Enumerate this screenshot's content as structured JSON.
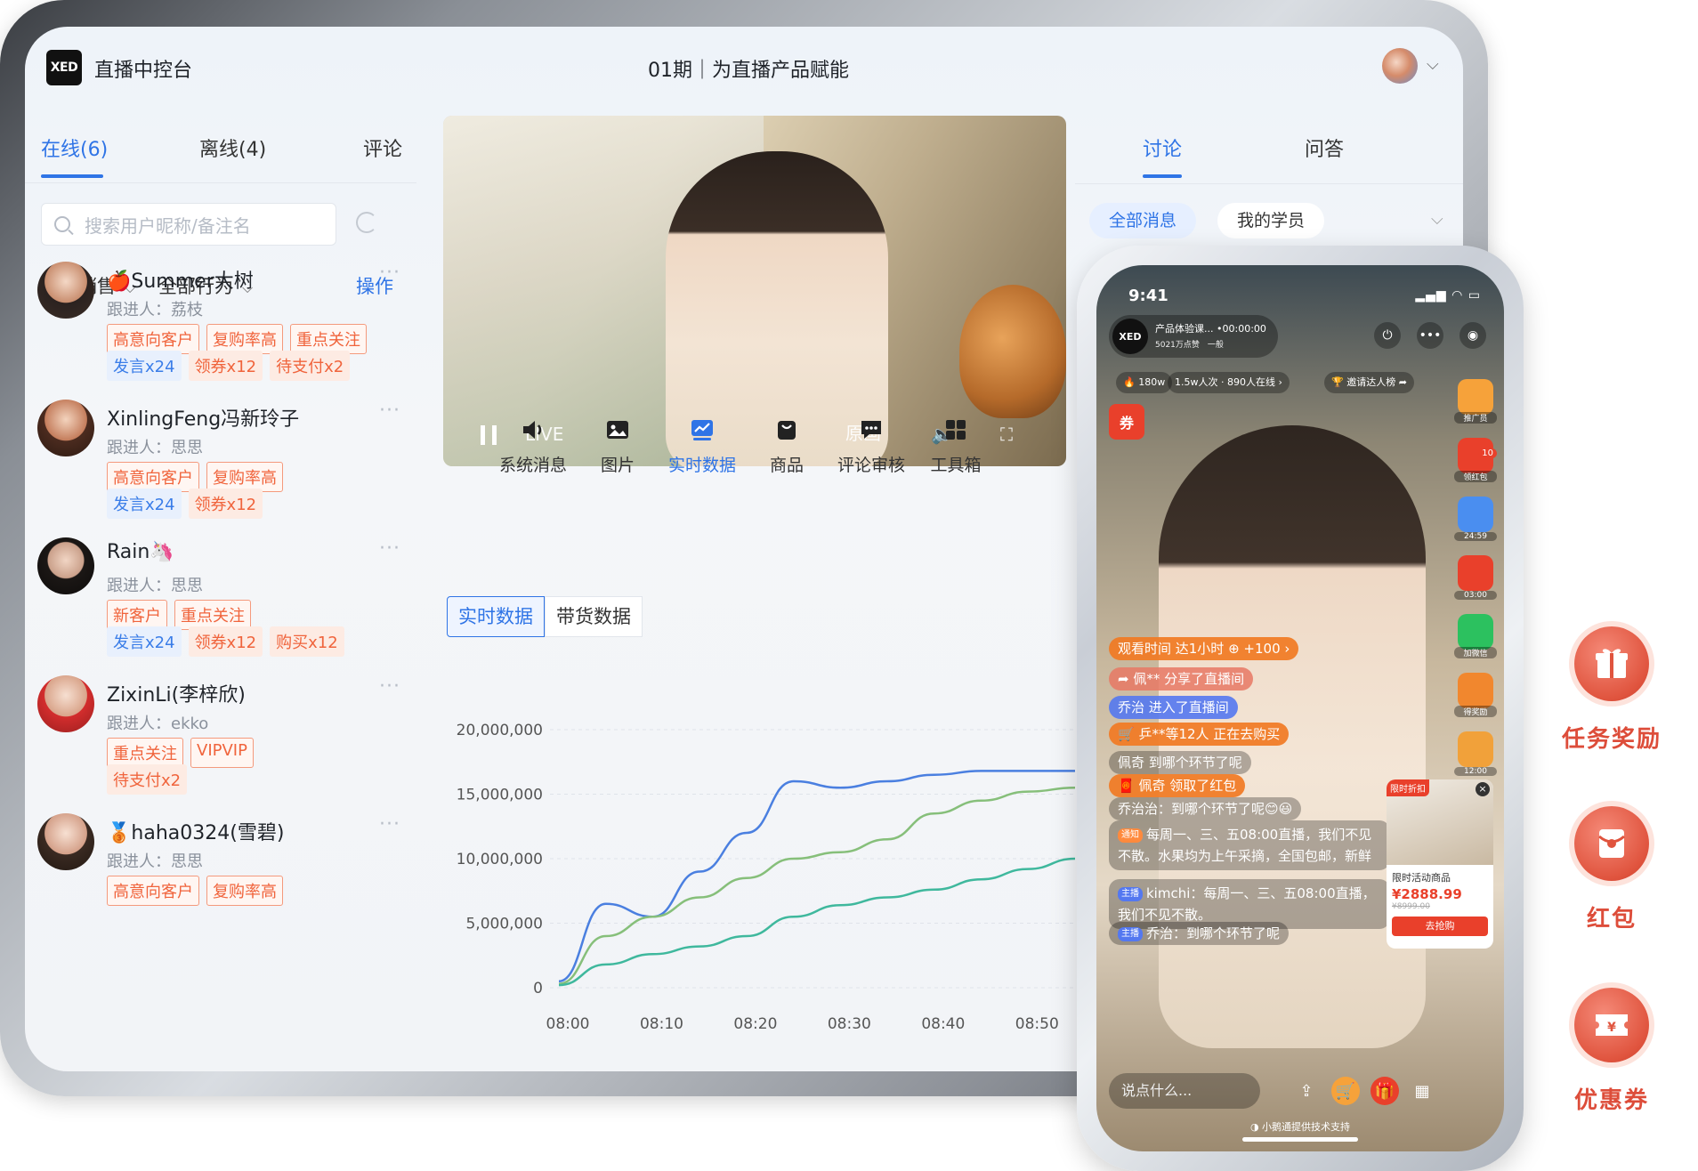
{
  "header": {
    "logo_text": "XED",
    "app_title": "直播中控台",
    "session_title": "01期｜为直播产品赋能"
  },
  "left_tabs": [
    {
      "label": "在线(6)",
      "active": true
    },
    {
      "label": "离线(4)",
      "active": false
    },
    {
      "label": "评论",
      "active": false
    }
  ],
  "search": {
    "placeholder": "搜索用户昵称/备注名"
  },
  "filters": {
    "sales": "全部销售",
    "behavior": "全部行为",
    "action": "操作"
  },
  "users": [
    {
      "name": "🍎Summer大树",
      "follower": "跟进人：荔枝",
      "tags1": [
        {
          "t": "高意向客户",
          "s": "red"
        },
        {
          "t": "复购率高",
          "s": "red"
        },
        {
          "t": "重点关注",
          "s": "red"
        }
      ],
      "tags2": [
        {
          "t": "发言x24",
          "s": "blue"
        },
        {
          "t": "领券x12",
          "s": "orange"
        },
        {
          "t": "待支付x2",
          "s": "orange"
        }
      ]
    },
    {
      "name": "XinlingFeng冯新玲子",
      "follower": "跟进人：思思",
      "tags1": [
        {
          "t": "高意向客户",
          "s": "red"
        },
        {
          "t": "复购率高",
          "s": "red"
        }
      ],
      "tags2": [
        {
          "t": "发言x24",
          "s": "blue"
        },
        {
          "t": "领券x12",
          "s": "orange"
        }
      ]
    },
    {
      "name": "Rain🦄",
      "follower": "跟进人：思思",
      "tags1": [
        {
          "t": "新客户",
          "s": "red"
        },
        {
          "t": "重点关注",
          "s": "red"
        }
      ],
      "tags2": [
        {
          "t": "发言x24",
          "s": "blue"
        },
        {
          "t": "领券x12",
          "s": "orange"
        },
        {
          "t": "购买x12",
          "s": "orange"
        }
      ]
    },
    {
      "name": "ZixinLi(李梓欣)",
      "follower": "跟进人：ekko",
      "tags1": [
        {
          "t": "重点关注",
          "s": "red"
        },
        {
          "t": "VIPVIP",
          "s": "red"
        }
      ],
      "tags2": [
        {
          "t": "待支付x2",
          "s": "orange"
        }
      ]
    },
    {
      "name": "🥉haha0324(雪碧)",
      "follower": "跟进人：思思",
      "tags1": [
        {
          "t": "高意向客户",
          "s": "red"
        },
        {
          "t": "复购率高",
          "s": "red"
        }
      ],
      "tags2": []
    }
  ],
  "video": {
    "live_label": "LIVE",
    "quality_label": "原画"
  },
  "toolbar": [
    {
      "label": "系统消息",
      "icon": "speaker-icon",
      "active": false
    },
    {
      "label": "图片",
      "icon": "image-icon",
      "active": false
    },
    {
      "label": "实时数据",
      "icon": "chart-icon",
      "active": true
    },
    {
      "label": "商品",
      "icon": "bag-icon",
      "active": false
    },
    {
      "label": "评论审核",
      "icon": "comment-icon",
      "active": false
    },
    {
      "label": "工具箱",
      "icon": "grid-icon",
      "active": false
    }
  ],
  "segments": [
    "实时数据",
    "带货数据"
  ],
  "chart_data": {
    "type": "line",
    "x": [
      "08:00",
      "08:05",
      "08:10",
      "08:15",
      "08:20",
      "08:25",
      "08:30",
      "08:35",
      "08:40",
      "08:45",
      "08:50",
      "08:55"
    ],
    "x_ticks": [
      "08:00",
      "08:10",
      "08:20",
      "08:30",
      "08:40",
      "08:50"
    ],
    "y_ticks": [
      "0",
      "5,000,000",
      "10,000,000",
      "15,000,000",
      "20,000,000"
    ],
    "ylim": [
      0,
      20000000
    ],
    "grid": true,
    "series": [
      {
        "values": [
          500000,
          6500000,
          5500000,
          9000000,
          12000000,
          16000000,
          15500000,
          16000000,
          16500000,
          16800000,
          16800000,
          16800000
        ],
        "color": "#4a7fe0"
      },
      {
        "values": [
          300000,
          4000000,
          5500000,
          7000000,
          8500000,
          10000000,
          10500000,
          11500000,
          13500000,
          14500000,
          15200000,
          15500000
        ],
        "color": "#86bf7a"
      },
      {
        "values": [
          200000,
          1800000,
          2600000,
          3200000,
          4000000,
          5500000,
          6400000,
          7000000,
          7600000,
          8400000,
          9200000,
          10000000
        ],
        "color": "#3fb89d"
      }
    ]
  },
  "right_tabs": [
    {
      "label": "讨论",
      "active": true
    },
    {
      "label": "问答",
      "active": false
    }
  ],
  "right_pills": [
    "全部消息",
    "我的学员"
  ],
  "phone": {
    "time": "9:41",
    "host_name": "产品体验课...",
    "host_timer": "•00:00:00",
    "host_likes": "5021万点赞",
    "host_level": "一般",
    "stat_heat": "180w",
    "stat_view": "1.5w人次 · 890人在线 ›",
    "stat_invite": "邀请达人榜",
    "coupon_label": "券",
    "side": [
      {
        "label": "推广员",
        "color": "#f6a23a"
      },
      {
        "label": "领红包",
        "color": "#e9402b"
      },
      {
        "label": "24:59",
        "color": "#4a8ef0"
      },
      {
        "label": "03:00",
        "color": "#e9402b"
      },
      {
        "label": "加微信",
        "color": "#2cc15f"
      },
      {
        "label": "得奖励",
        "color": "#f1872e"
      },
      {
        "label": "12:00",
        "color": "#f1a13a"
      }
    ],
    "side_badge": "10",
    "messages": [
      {
        "text": "观看时间 达1小时 ⊕ +100 ›",
        "style": "orange",
        "top": 418
      },
      {
        "text": "➦ 佩** 分享了直播间",
        "style": "pink",
        "top": 452
      },
      {
        "text": "乔治 进入了直播间",
        "style": "blue",
        "top": 484
      },
      {
        "text": "🛒 乒**等12人 正在去购买",
        "style": "orange",
        "top": 514
      },
      {
        "text": "佩奇 到哪个环节了呢",
        "style": "dark",
        "top": 546
      },
      {
        "text": "🧧 佩奇 领取了红包",
        "style": "orange",
        "top": 572
      },
      {
        "text": "乔治治：到哪个环节了呢😊😃",
        "style": "dark",
        "top": 598
      }
    ],
    "notice_chip": "通知",
    "notice_text": "每周一、三、五08:00直播，我们不见不散。水果均为上午采摘，全国包邮，新鲜",
    "host_chip": "主播",
    "host_msg": "kimchi：每周一、三、五08:00直播，我们不见不散。",
    "host_msg2": "乔治：到哪个环节了呢",
    "product": {
      "tag": "限时折扣",
      "name": "限时活动商品",
      "price": "¥2888.99",
      "orig": "¥8999.00",
      "btn": "去抢购"
    },
    "input_placeholder": "说点什么...",
    "footer": "小鹅通提供技术支持"
  },
  "features": [
    {
      "label": "任务奖励",
      "icon": "gift-icon"
    },
    {
      "label": "红包",
      "icon": "red-envelope-icon"
    },
    {
      "label": "优惠券",
      "icon": "coupon-icon"
    }
  ]
}
